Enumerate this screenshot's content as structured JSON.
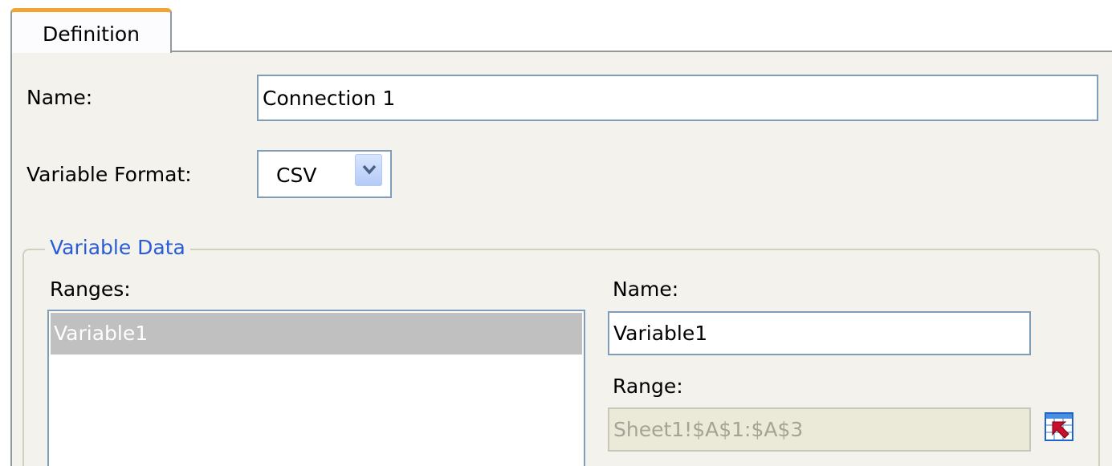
{
  "tabs": [
    {
      "label": "Definition"
    }
  ],
  "connection": {
    "name_label": "Name:",
    "name_value": "Connection 1",
    "format_label": "Variable Format:",
    "format_value": "CSV"
  },
  "variable_data": {
    "title": "Variable Data",
    "ranges_label": "Ranges:",
    "ranges": [
      {
        "label": "Variable1",
        "selected": true
      }
    ],
    "name_label": "Name:",
    "name_value": "Variable1",
    "range_label": "Range:",
    "range_value": "Sheet1!$A$1:$A$3"
  },
  "icons": {
    "format_dropdown": "chevron-down-icon",
    "range_picker": "range-picker-icon"
  },
  "colors": {
    "tab_accent": "#f0a533",
    "panel_bg": "#f3f2ec",
    "group_title": "#2a5cd8",
    "selection": "#c0c0c0",
    "field_border": "#7f9db9"
  }
}
